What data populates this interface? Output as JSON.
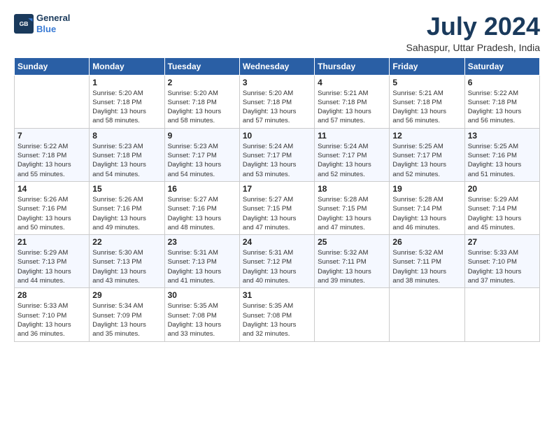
{
  "header": {
    "logo_line1": "General",
    "logo_line2": "Blue",
    "title": "July 2024",
    "subtitle": "Sahaspur, Uttar Pradesh, India"
  },
  "weekdays": [
    "Sunday",
    "Monday",
    "Tuesday",
    "Wednesday",
    "Thursday",
    "Friday",
    "Saturday"
  ],
  "weeks": [
    [
      {
        "day": "",
        "info": ""
      },
      {
        "day": "1",
        "info": "Sunrise: 5:20 AM\nSunset: 7:18 PM\nDaylight: 13 hours\nand 58 minutes."
      },
      {
        "day": "2",
        "info": "Sunrise: 5:20 AM\nSunset: 7:18 PM\nDaylight: 13 hours\nand 58 minutes."
      },
      {
        "day": "3",
        "info": "Sunrise: 5:20 AM\nSunset: 7:18 PM\nDaylight: 13 hours\nand 57 minutes."
      },
      {
        "day": "4",
        "info": "Sunrise: 5:21 AM\nSunset: 7:18 PM\nDaylight: 13 hours\nand 57 minutes."
      },
      {
        "day": "5",
        "info": "Sunrise: 5:21 AM\nSunset: 7:18 PM\nDaylight: 13 hours\nand 56 minutes."
      },
      {
        "day": "6",
        "info": "Sunrise: 5:22 AM\nSunset: 7:18 PM\nDaylight: 13 hours\nand 56 minutes."
      }
    ],
    [
      {
        "day": "7",
        "info": "Sunrise: 5:22 AM\nSunset: 7:18 PM\nDaylight: 13 hours\nand 55 minutes."
      },
      {
        "day": "8",
        "info": "Sunrise: 5:23 AM\nSunset: 7:18 PM\nDaylight: 13 hours\nand 54 minutes."
      },
      {
        "day": "9",
        "info": "Sunrise: 5:23 AM\nSunset: 7:17 PM\nDaylight: 13 hours\nand 54 minutes."
      },
      {
        "day": "10",
        "info": "Sunrise: 5:24 AM\nSunset: 7:17 PM\nDaylight: 13 hours\nand 53 minutes."
      },
      {
        "day": "11",
        "info": "Sunrise: 5:24 AM\nSunset: 7:17 PM\nDaylight: 13 hours\nand 52 minutes."
      },
      {
        "day": "12",
        "info": "Sunrise: 5:25 AM\nSunset: 7:17 PM\nDaylight: 13 hours\nand 52 minutes."
      },
      {
        "day": "13",
        "info": "Sunrise: 5:25 AM\nSunset: 7:16 PM\nDaylight: 13 hours\nand 51 minutes."
      }
    ],
    [
      {
        "day": "14",
        "info": "Sunrise: 5:26 AM\nSunset: 7:16 PM\nDaylight: 13 hours\nand 50 minutes."
      },
      {
        "day": "15",
        "info": "Sunrise: 5:26 AM\nSunset: 7:16 PM\nDaylight: 13 hours\nand 49 minutes."
      },
      {
        "day": "16",
        "info": "Sunrise: 5:27 AM\nSunset: 7:16 PM\nDaylight: 13 hours\nand 48 minutes."
      },
      {
        "day": "17",
        "info": "Sunrise: 5:27 AM\nSunset: 7:15 PM\nDaylight: 13 hours\nand 47 minutes."
      },
      {
        "day": "18",
        "info": "Sunrise: 5:28 AM\nSunset: 7:15 PM\nDaylight: 13 hours\nand 47 minutes."
      },
      {
        "day": "19",
        "info": "Sunrise: 5:28 AM\nSunset: 7:14 PM\nDaylight: 13 hours\nand 46 minutes."
      },
      {
        "day": "20",
        "info": "Sunrise: 5:29 AM\nSunset: 7:14 PM\nDaylight: 13 hours\nand 45 minutes."
      }
    ],
    [
      {
        "day": "21",
        "info": "Sunrise: 5:29 AM\nSunset: 7:13 PM\nDaylight: 13 hours\nand 44 minutes."
      },
      {
        "day": "22",
        "info": "Sunrise: 5:30 AM\nSunset: 7:13 PM\nDaylight: 13 hours\nand 43 minutes."
      },
      {
        "day": "23",
        "info": "Sunrise: 5:31 AM\nSunset: 7:13 PM\nDaylight: 13 hours\nand 41 minutes."
      },
      {
        "day": "24",
        "info": "Sunrise: 5:31 AM\nSunset: 7:12 PM\nDaylight: 13 hours\nand 40 minutes."
      },
      {
        "day": "25",
        "info": "Sunrise: 5:32 AM\nSunset: 7:11 PM\nDaylight: 13 hours\nand 39 minutes."
      },
      {
        "day": "26",
        "info": "Sunrise: 5:32 AM\nSunset: 7:11 PM\nDaylight: 13 hours\nand 38 minutes."
      },
      {
        "day": "27",
        "info": "Sunrise: 5:33 AM\nSunset: 7:10 PM\nDaylight: 13 hours\nand 37 minutes."
      }
    ],
    [
      {
        "day": "28",
        "info": "Sunrise: 5:33 AM\nSunset: 7:10 PM\nDaylight: 13 hours\nand 36 minutes."
      },
      {
        "day": "29",
        "info": "Sunrise: 5:34 AM\nSunset: 7:09 PM\nDaylight: 13 hours\nand 35 minutes."
      },
      {
        "day": "30",
        "info": "Sunrise: 5:35 AM\nSunset: 7:08 PM\nDaylight: 13 hours\nand 33 minutes."
      },
      {
        "day": "31",
        "info": "Sunrise: 5:35 AM\nSunset: 7:08 PM\nDaylight: 13 hours\nand 32 minutes."
      },
      {
        "day": "",
        "info": ""
      },
      {
        "day": "",
        "info": ""
      },
      {
        "day": "",
        "info": ""
      }
    ]
  ]
}
